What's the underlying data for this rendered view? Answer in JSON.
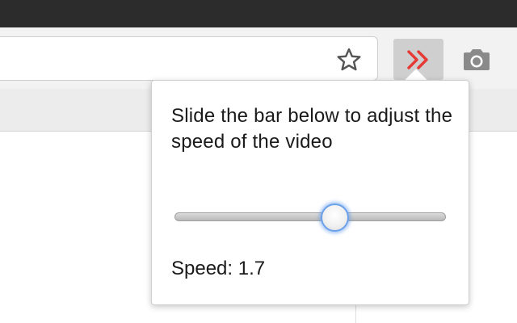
{
  "browser": {
    "icons": {
      "bookmark": "star-icon",
      "extension": "double-chevron-right-icon",
      "screenshot": "camera-icon"
    },
    "colors": {
      "extension_icon": "#e53935",
      "extension_button_bg": "#cfcfcf",
      "title_bar": "#2c2c2c"
    }
  },
  "popup": {
    "instructions": "Slide the bar below to adjust the speed of the video",
    "speed_label": "Speed:",
    "speed_value": "1.7",
    "slider": {
      "value": 1.7,
      "position_fraction": 0.59
    },
    "colors": {
      "thumb_glow": "#6aa0ea"
    }
  }
}
